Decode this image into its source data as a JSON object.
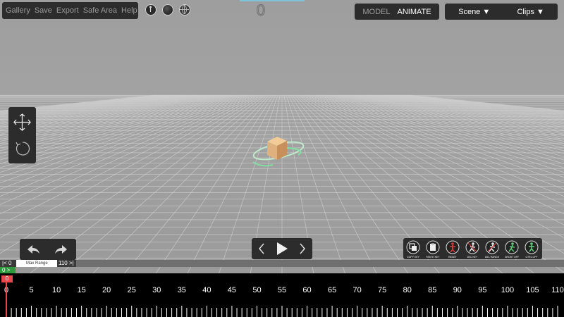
{
  "menu": {
    "items": [
      "Gallery",
      "Save",
      "Export",
      "Safe Area",
      "Help"
    ]
  },
  "frame_counter": "0",
  "mode": {
    "model_label": "MODEL",
    "animate_label": "ANIMATE",
    "active": "ANIMATE"
  },
  "dropdowns": {
    "scene_label": "Scene",
    "clips_label": "Clips"
  },
  "colors": {
    "accent_playhead": "#e8464a",
    "start_marker": "#2d9a3e",
    "cube": "#e0b07e",
    "ring": "#7fe0a0"
  },
  "tools": {
    "move_icon": "move-arrows-icon",
    "rotate_icon": "rotate-icon"
  },
  "key_buttons": [
    {
      "label": "COPY KEY",
      "icon": "copy-key-icon"
    },
    {
      "label": "PASTE KEY",
      "icon": "paste-key-icon"
    },
    {
      "label": "RESET",
      "icon": "reset-figure-icon"
    },
    {
      "label": "DEL KEY",
      "icon": "delete-key-icon"
    },
    {
      "label": "DEL RANGE",
      "icon": "delete-range-icon"
    },
    {
      "label": "GHOST OFF",
      "icon": "ghost-off-icon"
    },
    {
      "label": "CTRL OFF",
      "icon": "ctrl-off-icon"
    }
  ],
  "range": {
    "min_label": "|< 0",
    "label": "Max Range",
    "max_label": "110 >|",
    "start_marker": "0 >"
  },
  "timeline": {
    "playhead": "0",
    "ticks": [
      "0",
      "5",
      "10",
      "15",
      "20",
      "25",
      "30",
      "35",
      "40",
      "45",
      "50",
      "55",
      "60",
      "65",
      "70",
      "75",
      "80",
      "85",
      "90",
      "95",
      "100",
      "105",
      "110"
    ],
    "max_frame": 110
  }
}
